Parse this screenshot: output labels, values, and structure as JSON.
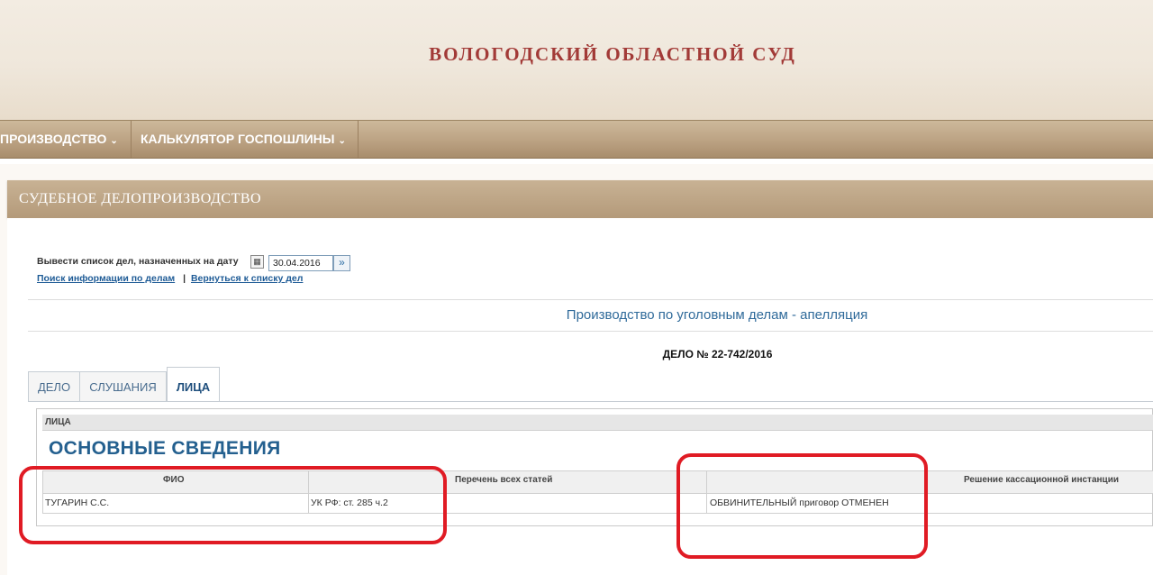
{
  "header": {
    "title": "ВОЛОГОДСКИЙ ОБЛАСТНОЙ СУД"
  },
  "nav": {
    "items": [
      {
        "label": "ПРОИЗВОДСТВО"
      },
      {
        "label": "КАЛЬКУЛЯТОР ГОСПОШЛИНЫ"
      }
    ]
  },
  "panel": {
    "title": "СУДЕБНОЕ ДЕЛОПРОИЗВОДСТВО"
  },
  "date_filter": {
    "label": "Вывести список дел, назначенных на дату",
    "value": "30.04.2016"
  },
  "links": {
    "search": "Поиск информации по делам",
    "separator": "|",
    "back": "Вернуться к списку дел"
  },
  "section_title": "Производство по уголовным делам - апелляция",
  "case_number": "ДЕЛО № 22-742/2016",
  "tabs": [
    {
      "label": "ДЕЛО"
    },
    {
      "label": "СЛУШАНИЯ"
    },
    {
      "label": "ЛИЦА"
    }
  ],
  "persons": {
    "section_label": "ЛИЦА",
    "heading": "ОСНОВНЫЕ СВЕДЕНИЯ",
    "columns": [
      "ФИО",
      "Перечень всех статей",
      "Решение кассационной инстанции"
    ],
    "rows": [
      {
        "name": "ТУГАРИН С.С.",
        "articles": "УК РФ: ст. 285 ч.2",
        "decision": "ОБВИНИТЕЛЬНЫЙ приговор ОТМЕНЕН"
      }
    ]
  },
  "colors": {
    "title": "#a23a37",
    "link": "#1e5b96",
    "annotation": "#e01b24"
  }
}
